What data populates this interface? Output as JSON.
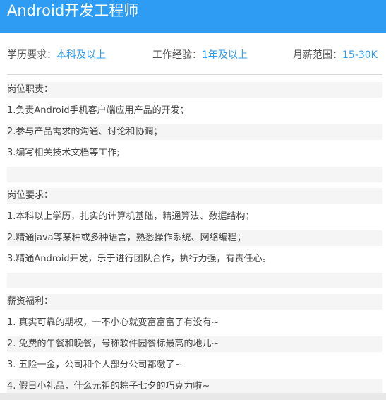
{
  "header": {
    "title": "Android开发工程师"
  },
  "meta": {
    "education_label": "学历要求：",
    "education_value": "本科及以上",
    "experience_label": "工作经验：",
    "experience_value": "1年及以上",
    "salary_label": "月薪范围：",
    "salary_value": "15-30K"
  },
  "responsibilities": {
    "title": "岗位职责：",
    "items": [
      "1.负责Android手机客户端应用产品的开发；",
      "2.参与产品需求的沟通、讨论和协调；",
      "3.编写相关技术文档等工作;"
    ]
  },
  "requirements": {
    "title": "岗位要求：",
    "items": [
      "1.本科以上学历，扎实的计算机基础，精通算法、数据结构；",
      "2.精通java等某种或多种语言，熟悉操作系统、网络编程；",
      "3.精通Android开发，乐于进行团队合作，执行力强，有责任心。"
    ]
  },
  "benefits": {
    "title": "薪资福利：",
    "items": [
      "1. 真实可靠的期权，一不小心就变富富富了有没有~",
      "2. 免费的午餐和晚餐，号称软件园餐标最高的地儿~",
      "3. 五险一金，公司和个人部分公司都缴了~",
      "4. 假日小礼品，什么元祖的粽子七夕的巧克力啦~"
    ]
  },
  "colors": {
    "header_bg": "#2f9cf3",
    "accent": "#2f9cf3",
    "row_shade": "#f5f5f5"
  }
}
